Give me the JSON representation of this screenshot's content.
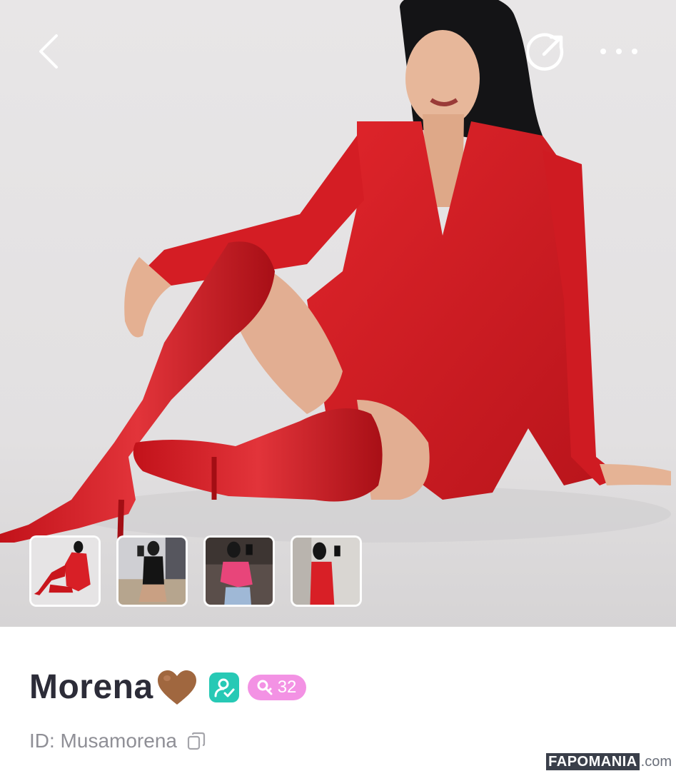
{
  "header": {
    "back_icon": "chevron-left-icon",
    "share_icon": "share-arrow-icon",
    "more_icon": "more-dots-icon"
  },
  "hero": {
    "photo": "woman-in-red-blazer-and-red-boots",
    "thumbnails": [
      {
        "subject": "red-blazer-boots",
        "selected": true
      },
      {
        "subject": "black-tank-gym-mirror",
        "selected": false
      },
      {
        "subject": "pink-halter-top-mirror",
        "selected": false
      },
      {
        "subject": "red-dress-mirror",
        "selected": false
      }
    ]
  },
  "profile": {
    "name": "Morena",
    "heart_emoji": "🤎",
    "verified_icon": "verified-user-icon",
    "level_icon": "level-key-icon",
    "level_value": "32",
    "id_label": "ID: Musamorena",
    "copy_icon": "copy-icon"
  },
  "watermark": {
    "brand": "FAPOMANIA",
    "tld": ".com"
  },
  "colors": {
    "verified_badge": "#27c9b5",
    "level_badge": "#f392e4",
    "name_text": "#2c2c38",
    "id_text": "#8f8f96",
    "outfit_red": "#d81f26"
  }
}
